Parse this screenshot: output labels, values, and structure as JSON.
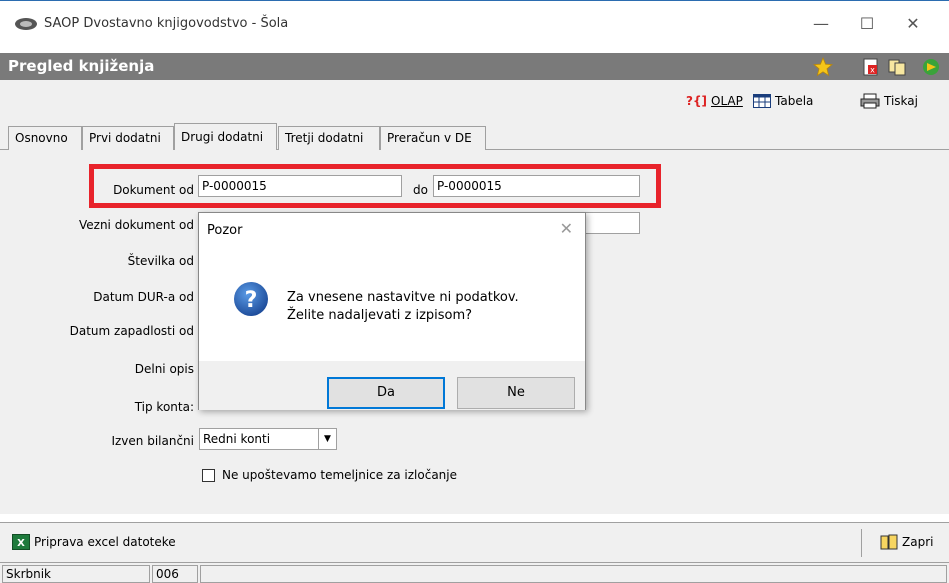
{
  "window": {
    "title": "SAOP  Dvostavno knjigovodstvo - Šola",
    "minimize": "—",
    "maximize": "☐",
    "close": "✕"
  },
  "header": {
    "title": "Pregled knjiženja"
  },
  "toolbar": {
    "olap_label": "OLAP",
    "tabela_label": "Tabela",
    "tiskaj_label": "Tiskaj"
  },
  "tabs": [
    {
      "label": "Osnovno"
    },
    {
      "label": "Prvi dodatni"
    },
    {
      "label": "Drugi dodatni"
    },
    {
      "label": "Tretji dodatni"
    },
    {
      "label": "Preračun v DE"
    }
  ],
  "form": {
    "dokument_od_label": "Dokument od",
    "dokument_od_value": "P-0000015",
    "do_label": "do",
    "dokument_do_value": "P-0000015",
    "vezni_label": "Vezni dokument od",
    "stevilka_label": "Številka od",
    "datum_dur_label": "Datum DUR-a od",
    "datum_zap_label": "Datum zapadlosti od",
    "delni_opis_label": "Delni opis",
    "tip_konta_label": "Tip konta:",
    "izven_label": "Izven bilančni",
    "izven_value": "Redni konti",
    "checkbox_label": "Ne upoštevamo temeljnice za izločanje"
  },
  "dialog": {
    "title": "Pozor",
    "close": "✕",
    "message_line1": "Za vnesene nastavitve ni podatkov.",
    "message_line2": "Želite nadaljevati z izpisom?",
    "yes_label": "Da",
    "no_label": "Ne"
  },
  "bottom": {
    "excel_label": "Priprava excel datoteke",
    "zapri_label": "Zapri"
  },
  "status": {
    "user": "Skrbnik",
    "code": "006"
  },
  "colors": {
    "highlight": "#e8232b",
    "header_bg": "#7a7a7a",
    "dialog_accent": "#0078d7"
  }
}
